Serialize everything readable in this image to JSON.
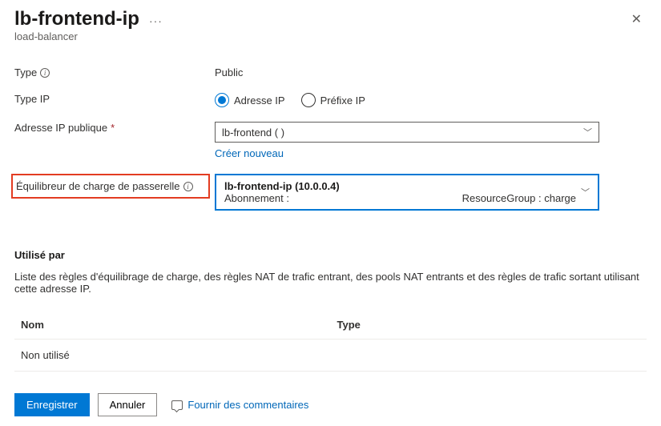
{
  "header": {
    "title": "lb-frontend-ip",
    "subtitle": "load-balancer"
  },
  "form": {
    "type_label": "Type",
    "type_value": "Public",
    "type_ip_label": "Type IP",
    "radio_ip": "Adresse IP",
    "radio_prefix": "Préfixe IP",
    "public_ip_label": "Adresse IP publique",
    "public_ip_value": "lb-frontend (                          )",
    "create_new": "Créer nouveau",
    "gateway_lb_label": "Équilibreur de charge de passerelle",
    "gateway_lb_title": "lb-frontend-ip (10.0.0.4)",
    "gateway_lb_sub_left": "Abonnement :",
    "gateway_lb_sub_right": "ResourceGroup : charge"
  },
  "used_by": {
    "heading": "Utilisé par",
    "description": "Liste des règles d'équilibrage de charge, des règles NAT de trafic entrant, des pools NAT entrants et des règles de trafic sortant utilisant cette adresse IP.",
    "col_name": "Nom",
    "col_type": "Type",
    "row_name": "Non utilisé",
    "row_type": ""
  },
  "footer": {
    "save": "Enregistrer",
    "cancel": "Annuler",
    "feedback": "Fournir des commentaires"
  }
}
